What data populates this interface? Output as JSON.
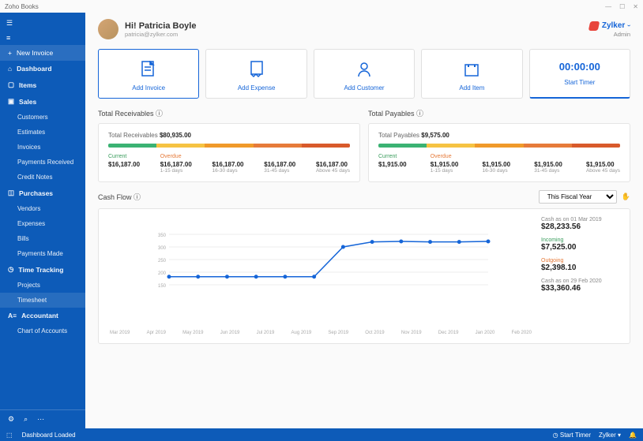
{
  "titlebar": {
    "app_name": "Zoho Books"
  },
  "sidebar": {
    "new_invoice": "New Invoice",
    "items": [
      {
        "label": "Dashboard",
        "icon": "home"
      },
      {
        "label": "Items",
        "icon": "tag"
      }
    ],
    "sales_group": "Sales",
    "sales": [
      "Customers",
      "Estimates",
      "Invoices",
      "Payments Received",
      "Credit Notes"
    ],
    "purchases_group": "Purchases",
    "purchases": [
      "Vendors",
      "Expenses",
      "Bills",
      "Payments Made"
    ],
    "time_group": "Time Tracking",
    "time": [
      "Projects",
      "Timesheet"
    ],
    "accountant_group": "Accountant",
    "accountant": [
      "Chart of Accounts"
    ]
  },
  "header": {
    "greeting": "Hi! Patricia Boyle",
    "email": "patricia@zylker.com",
    "brand": "Zylker",
    "role": "Admin"
  },
  "quick_actions": {
    "add_invoice": "Add Invoice",
    "add_expense": "Add Expense",
    "add_customer": "Add Customer",
    "add_item": "Add Item",
    "timer_value": "00:00:00",
    "start_timer": "Start Timer"
  },
  "receivables": {
    "title": "Total Receivables ⓘ",
    "total_label": "Total Receivables",
    "total_value": "$80,935.00",
    "bar_colors": [
      "#3bb273",
      "#f6c343",
      "#f09a2a",
      "#e67b3a",
      "#d85a2b"
    ],
    "bar_weights": [
      20,
      20,
      20,
      20,
      20
    ],
    "buckets": [
      {
        "label": "Current",
        "color": "#3a9d5d",
        "value": "$16,187.00",
        "days": ""
      },
      {
        "label": "Overdue",
        "color": "#e67b3a",
        "value": "$16,187.00",
        "days": "1-15 days"
      },
      {
        "label": "",
        "color": "",
        "value": "$16,187.00",
        "days": "16-30 days"
      },
      {
        "label": "",
        "color": "",
        "value": "$16,187.00",
        "days": "31-45 days"
      },
      {
        "label": "",
        "color": "",
        "value": "$16,187.00",
        "days": "Above 45 days"
      }
    ]
  },
  "payables": {
    "title": "Total Payables ⓘ",
    "total_label": "Total Payables",
    "total_value": "$9,575.00",
    "bar_colors": [
      "#3bb273",
      "#f6c343",
      "#f09a2a",
      "#e67b3a",
      "#d85a2b"
    ],
    "bar_weights": [
      20,
      20,
      20,
      20,
      20
    ],
    "buckets": [
      {
        "label": "Current",
        "color": "#3a9d5d",
        "value": "$1,915.00",
        "days": ""
      },
      {
        "label": "Overdue",
        "color": "#e67b3a",
        "value": "$1,915.00",
        "days": "1-15 days"
      },
      {
        "label": "",
        "color": "",
        "value": "$1,915.00",
        "days": "16-30 days"
      },
      {
        "label": "",
        "color": "",
        "value": "$1,915.00",
        "days": "31-45 days"
      },
      {
        "label": "",
        "color": "",
        "value": "$1,915.00",
        "days": "Above 45 days"
      }
    ]
  },
  "cashflow": {
    "title": "Cash Flow ⓘ",
    "period": "This Fiscal Year",
    "opening_label": "Cash as on 01 Mar 2019",
    "opening_value": "$28,233.56",
    "incoming_label": "Incoming",
    "incoming_value": "$7,525.00",
    "outgoing_label": "Outgoing",
    "outgoing_value": "$2,398.10",
    "closing_label": "Cash as on 29 Feb 2020",
    "closing_value": "$33,360.46"
  },
  "chart_data": {
    "type": "line",
    "title": "Cash Flow",
    "xlabel": "",
    "ylabel": "",
    "ylim": [
      0,
      400
    ],
    "yticks": [
      150,
      200,
      250,
      300,
      350
    ],
    "categories": [
      "Mar 2019",
      "Apr 2019",
      "May 2019",
      "Jun 2019",
      "Jul 2019",
      "Aug 2019",
      "Sep 2019",
      "Oct 2019",
      "Nov 2019",
      "Dec 2019",
      "Jan 2020",
      "Feb 2020"
    ],
    "values": [
      182,
      182,
      182,
      182,
      182,
      182,
      300,
      320,
      322,
      320,
      320,
      322
    ]
  },
  "statusbar": {
    "left": "Dashboard Loaded",
    "timer": "Start Timer",
    "org": "Zylker"
  }
}
